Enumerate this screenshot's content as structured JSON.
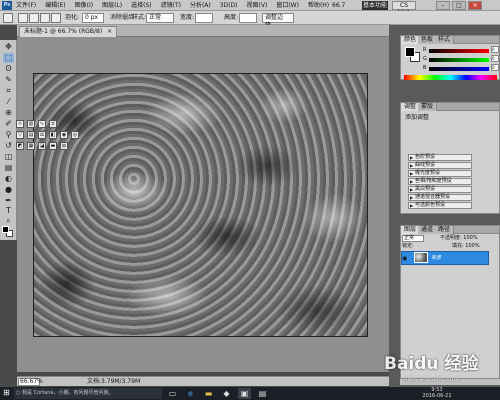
{
  "menubar": {
    "app_logo": "Ps",
    "items": [
      "文件(F)",
      "编辑(E)",
      "图像(I)",
      "图层(L)",
      "选择(S)",
      "滤镜(T)",
      "分析(A)",
      "3D(D)",
      "视图(V)",
      "窗口(W)",
      "帮助(H)"
    ],
    "zoom_readout": "66.7",
    "workspace_button": "基本功能",
    "cs_live": "CS Live"
  },
  "optbar": {
    "feather_label": "羽化:",
    "feather_value": "0 px",
    "antialias_label": "消除锯齿",
    "style_label": "样式:",
    "style_value": "正常",
    "width_label": "宽度:",
    "height_label": "高度:",
    "refine_edge": "调整边缘..."
  },
  "document": {
    "tab_title": "未标题-1 @ 66.7% (RGB/8)",
    "tab_close": "×"
  },
  "statusbar": {
    "zoom": "66.67%",
    "doc_info": "文档:3.79M/3.79M"
  },
  "color_panel": {
    "tabs": [
      "颜色",
      "色板",
      "样式"
    ],
    "channels": [
      {
        "label": "R",
        "value": "0"
      },
      {
        "label": "G",
        "value": "0"
      },
      {
        "label": "B",
        "value": "0"
      }
    ]
  },
  "adjustments_panel": {
    "tabs": [
      "调整",
      "蒙版"
    ],
    "title": "添加调整",
    "presets": [
      "色阶预设",
      "曲线预设",
      "曝光度预设",
      "色相/饱和度预设",
      "黑白预设",
      "通道混合器预设",
      "可选颜色预设"
    ]
  },
  "layers_panel": {
    "tabs": [
      "图层",
      "通道",
      "路径"
    ],
    "blend_mode": "正常",
    "opacity_label": "不透明度: 100%",
    "lock_label": "锁定:",
    "fill_label": "填充: 100%",
    "layer_name": "背景"
  },
  "taskbar": {
    "search_placeholder": "我是 Cortana，小娜。有问题尽管问我。",
    "time": "9:53",
    "date": "2016-06-21"
  },
  "watermark": {
    "text": "Baidu 经验",
    "url": "jingyan.baidu.com"
  },
  "colors": {
    "accent": "#2f8be2",
    "menubar": "#c8c8c8",
    "workspace": "#8f8f8f",
    "taskbar": "#1b1f26"
  }
}
